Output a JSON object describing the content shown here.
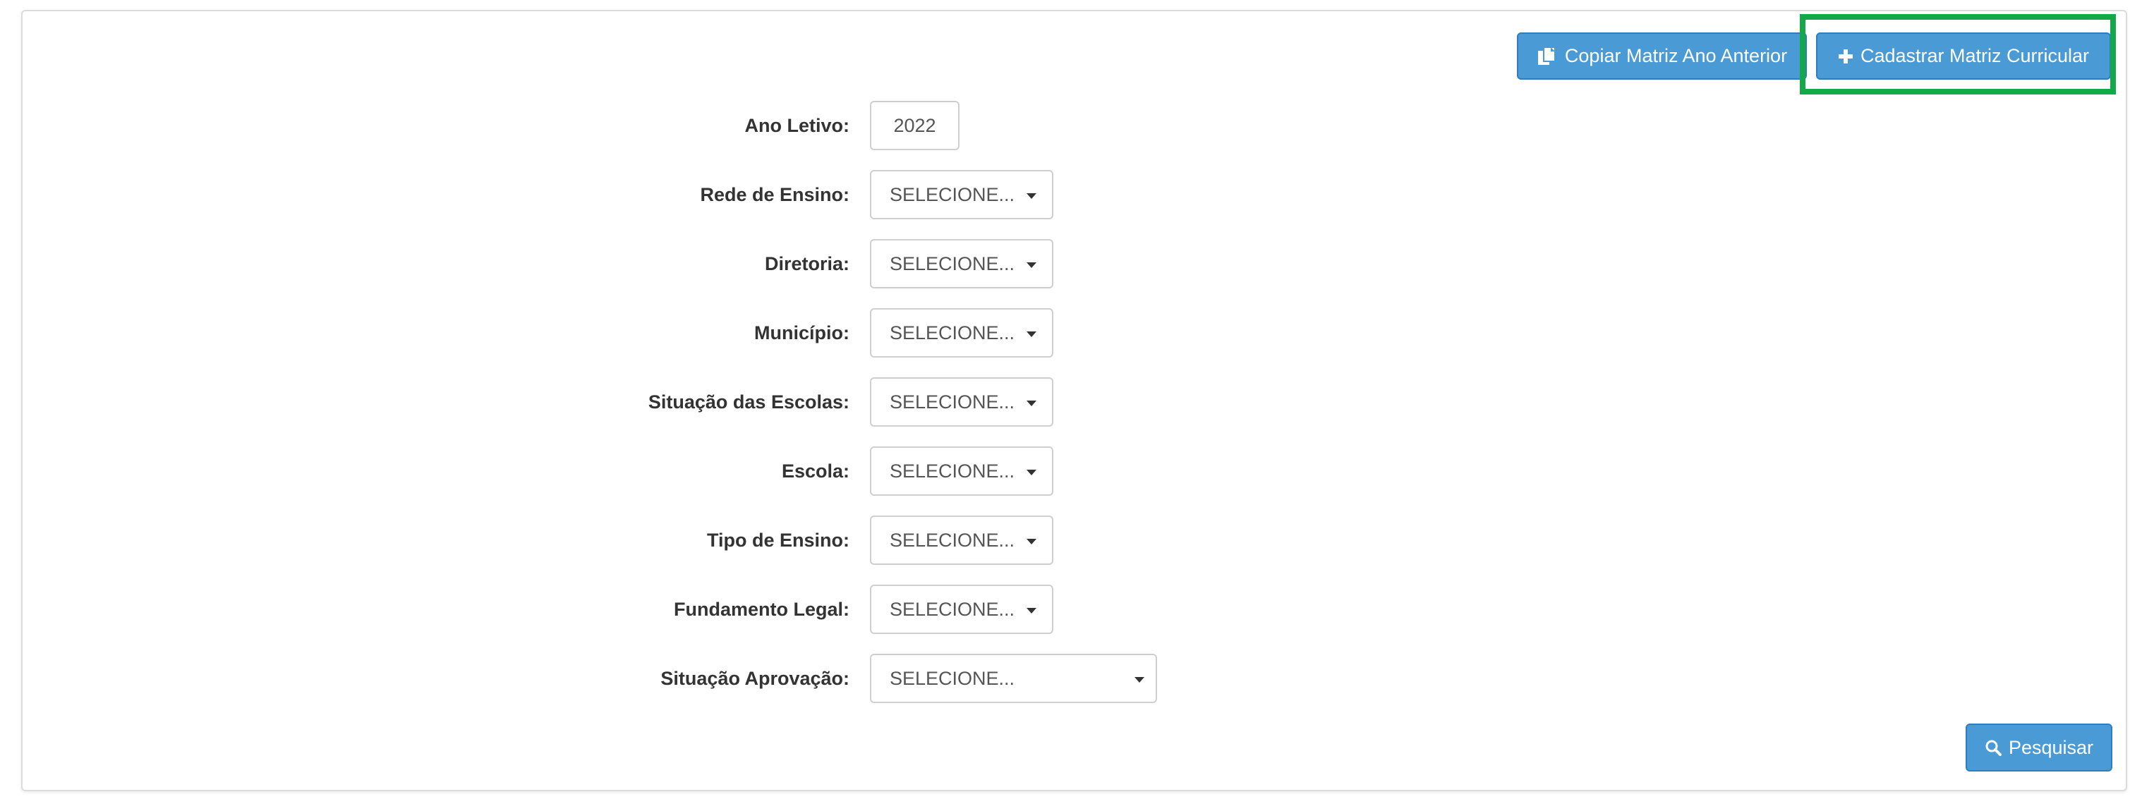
{
  "toolbar": {
    "copy_label": "Copiar Matriz Ano Anterior",
    "register_label": "Cadastrar Matriz Curricular"
  },
  "form": {
    "fields": [
      {
        "label": "Ano Letivo:",
        "value": "2022"
      },
      {
        "label": "Rede de Ensino:",
        "value": "SELECIONE..."
      },
      {
        "label": "Diretoria:",
        "value": "SELECIONE..."
      },
      {
        "label": "Município:",
        "value": "SELECIONE..."
      },
      {
        "label": "Situação das Escolas:",
        "value": "SELECIONE..."
      },
      {
        "label": "Escola:",
        "value": "SELECIONE..."
      },
      {
        "label": "Tipo de Ensino:",
        "value": "SELECIONE..."
      },
      {
        "label": "Fundamento Legal:",
        "value": "SELECIONE..."
      },
      {
        "label": "Situação Aprovação:",
        "value": "SELECIONE..."
      }
    ]
  },
  "search": {
    "label": "Pesquisar"
  },
  "colors": {
    "primary": "#4a9ad6",
    "primary_border": "#2f7dbf",
    "highlight": "#14a84a",
    "label_text": "#333333",
    "control_border": "#cfcfcf"
  },
  "icons": {
    "copy": "copy-icon",
    "plus": "plus-icon",
    "search": "search-icon",
    "caret": "caret-down-icon"
  }
}
